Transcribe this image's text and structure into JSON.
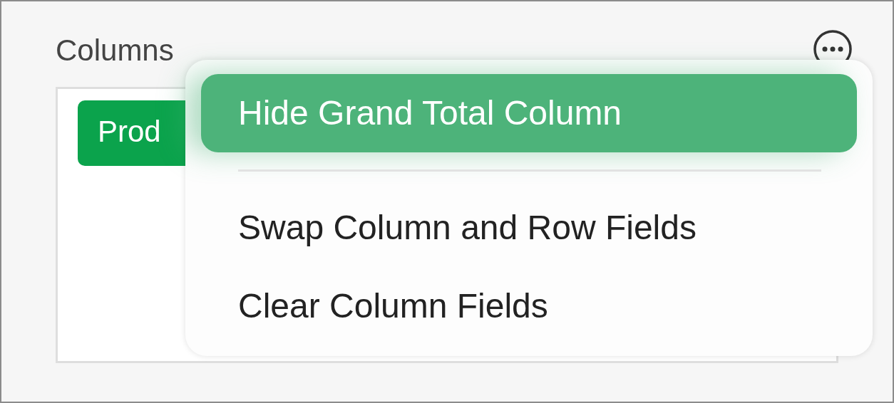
{
  "panel": {
    "title": "Columns",
    "fields": [
      {
        "label": "Prod"
      }
    ]
  },
  "menu": {
    "items": [
      {
        "kind": "item",
        "label": "Hide Grand Total Column",
        "selected": true
      },
      {
        "kind": "separator"
      },
      {
        "kind": "item",
        "label": "Swap Column and Row Fields",
        "selected": false
      },
      {
        "kind": "item",
        "label": "Clear Column Fields",
        "selected": false
      }
    ]
  }
}
